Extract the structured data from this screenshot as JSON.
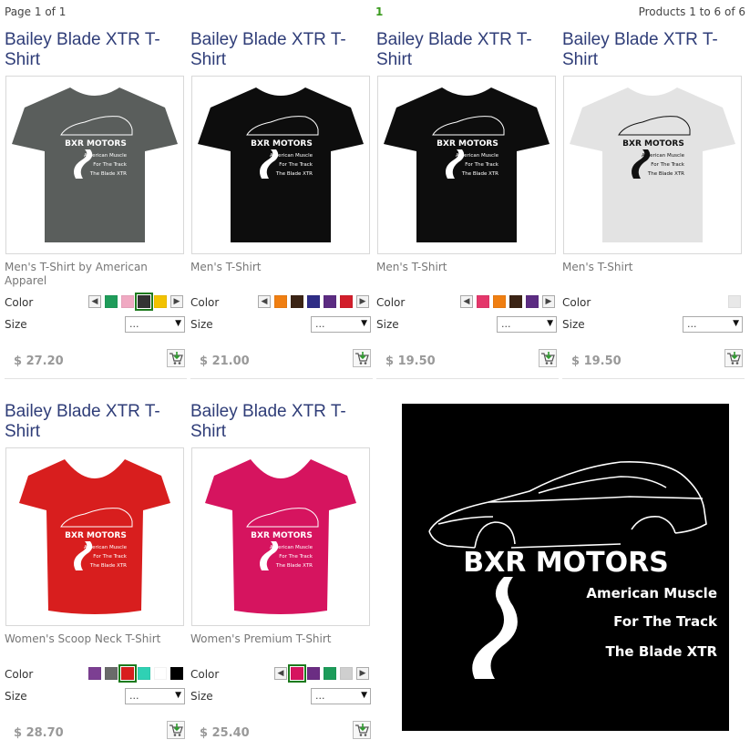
{
  "pagination": {
    "page_text": "Page 1 of 1",
    "current_page": "1",
    "products_text": "Products 1 to 6 of 6"
  },
  "labels": {
    "color": "Color",
    "size": "Size",
    "size_placeholder": "...",
    "prev_arrow": "◀",
    "next_arrow": "▶",
    "caret": "▼"
  },
  "products": [
    {
      "title": "Bailey Blade XTR T-Shirt",
      "type": "Men's T-Shirt by American Apparel",
      "price": "$ 27.20",
      "shirt_color": "#5a5e5c",
      "print_color": "#ffffff",
      "swatches": [
        "#1f9c5a",
        "#f0a9c2",
        "#333333",
        "#f2c200"
      ],
      "selected_swatch": 2,
      "has_arrows": true
    },
    {
      "title": "Bailey Blade XTR T-Shirt",
      "type": "Men's T-Shirt",
      "price": "$ 21.00",
      "shirt_color": "#0d0d0d",
      "print_color": "#ffffff",
      "swatches": [
        "#f07f12",
        "#3b2415",
        "#2f2d86",
        "#5c2c82",
        "#d21e2b"
      ],
      "selected_swatch": -1,
      "has_arrows": true
    },
    {
      "title": "Bailey Blade XTR T-Shirt",
      "type": "Men's T-Shirt",
      "price": "$ 19.50",
      "shirt_color": "#0d0d0d",
      "print_color": "#ffffff",
      "swatches": [
        "#e4376b",
        "#f07f12",
        "#3b2415",
        "#5c2c82"
      ],
      "selected_swatch": -1,
      "has_arrows": true
    },
    {
      "title": "Bailey Blade XTR T-Shirt",
      "type": "Men's T-Shirt",
      "price": "$ 19.50",
      "shirt_color": "#e3e3e3",
      "print_color": "#111111",
      "swatches": [
        "#e8e8e8"
      ],
      "selected_swatch": -1,
      "has_arrows": false
    },
    {
      "title": "Bailey Blade XTR T-Shirt",
      "type": "Women's Scoop Neck T-Shirt",
      "price": "$ 28.70",
      "shirt_color": "#d81e1e",
      "print_color": "#ffffff",
      "swatches": [
        "#7c3f92",
        "#6a6a6a",
        "#d81e1e",
        "#2fd1b4",
        "#ffffff",
        "#000000"
      ],
      "selected_swatch": 2,
      "has_arrows": false
    },
    {
      "title": "Bailey Blade XTR T-Shirt",
      "type": "Women's Premium T-Shirt",
      "price": "$ 25.40",
      "shirt_color": "#d6145f",
      "print_color": "#ffffff",
      "swatches": [
        "#d6145f",
        "#6b2d83",
        "#1c9c5a",
        "#cfcfcf"
      ],
      "selected_swatch": 0,
      "has_arrows": true
    }
  ],
  "banner": {
    "brand": "BXR MOTORS",
    "line1": "American Muscle",
    "line2": "For The Track",
    "line3": "The Blade XTR"
  },
  "colors": {
    "title": "#2f3d78",
    "page_number": "#3a9a1e",
    "selected_outline": "#1d7a1d"
  }
}
